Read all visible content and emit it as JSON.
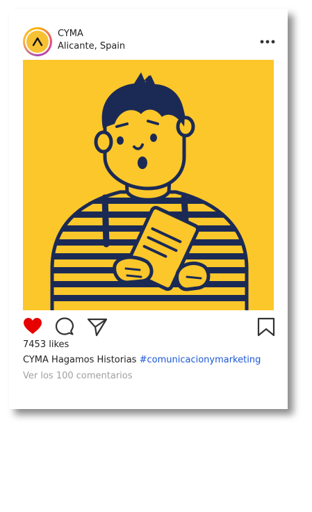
{
  "post": {
    "username": "CYMA",
    "location": "Alicante, Spain",
    "likes": "7453 likes",
    "caption_user": "CYMA",
    "caption_text": "Hagamos Historias",
    "caption_hashtag": "#comunicacionymarketing",
    "comments_link": "Ver los 100 comentarios",
    "liked": true
  },
  "icons": {
    "more": "more-icon",
    "like": "heart-icon",
    "comment": "comment-icon",
    "share": "send-icon",
    "save": "bookmark-icon"
  },
  "colors": {
    "accent_yellow": "#fcc72a",
    "illustration_navy": "#1b2a55",
    "like_red": "#e60000",
    "hashtag_blue": "#1a57d6",
    "muted_text": "#a0a0a0"
  }
}
